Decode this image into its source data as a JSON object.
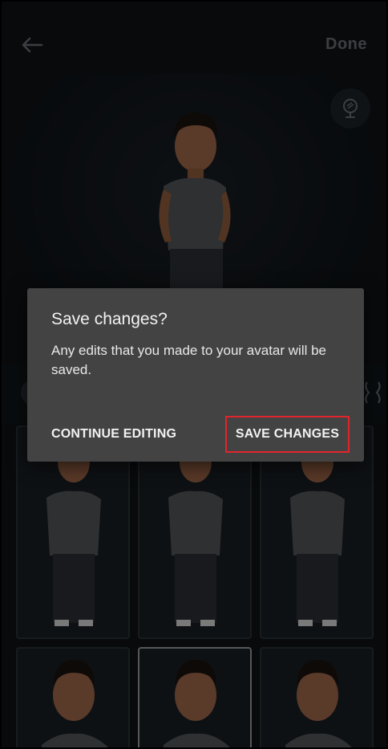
{
  "header": {
    "back_icon": "arrow-left-icon",
    "done_label": "Done",
    "mirror_icon": "mirror-icon"
  },
  "dialog": {
    "title": "Save changes?",
    "body": "Any edits that you made to your avatar will be saved.",
    "continue_label": "CONTINUE EDITING",
    "save_label": "SAVE CHANGES",
    "highlight_color": "#e0252c"
  },
  "grid": {
    "selected_index": 4
  }
}
